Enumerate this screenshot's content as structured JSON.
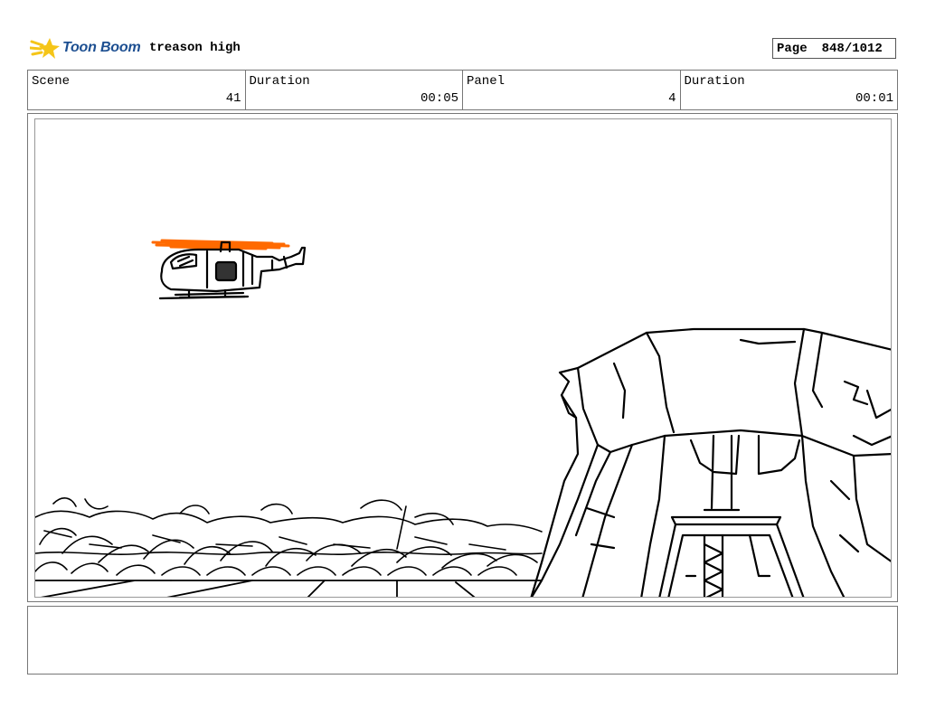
{
  "header": {
    "logo_text": "Toon Boom",
    "project_title": "treason high",
    "page_label": "Page",
    "page_value": "848/1012"
  },
  "info": {
    "scene_label": "Scene",
    "scene_value": "41",
    "duration1_label": "Duration",
    "duration1_value": "00:05",
    "panel_label": "Panel",
    "panel_value": "4",
    "duration2_label": "Duration",
    "duration2_value": "00:01"
  },
  "colors": {
    "logo_blue": "#1d4f91",
    "logo_star": "#f5c518",
    "rotor_orange": "#ff6a00"
  },
  "notes": {
    "text": ""
  }
}
